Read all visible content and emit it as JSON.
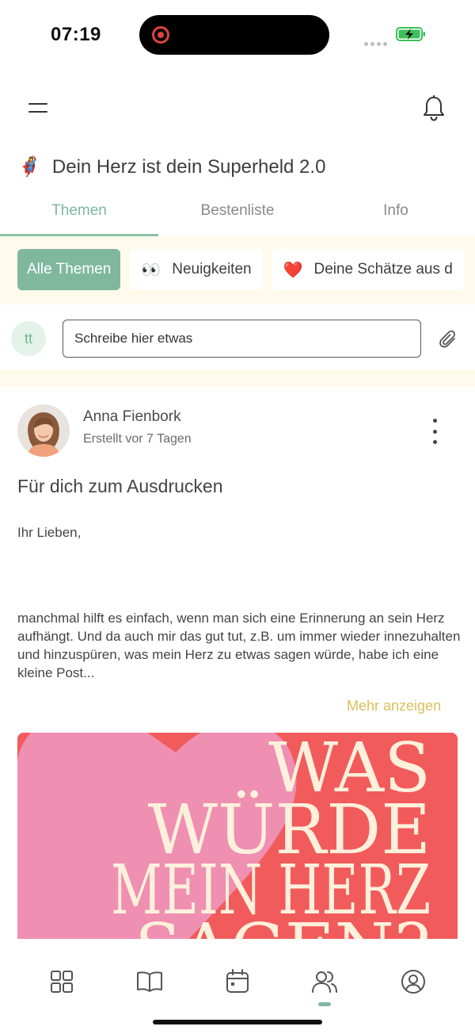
{
  "status_bar": {
    "time": "07:19"
  },
  "header": {
    "group_emoji": "🦸‍♀️",
    "group_name": "Dein Herz ist dein Superheld 2.0"
  },
  "tabs": [
    {
      "label": "Themen",
      "active": true
    },
    {
      "label": "Bestenliste",
      "active": false
    },
    {
      "label": "Info",
      "active": false
    }
  ],
  "filters": [
    {
      "emoji": "",
      "label": "Alle Themen",
      "active": true
    },
    {
      "emoji": "👀",
      "label": "Neuigkeiten",
      "active": false
    },
    {
      "emoji": "❤️",
      "label": "Deine Schätze aus d",
      "active": false
    }
  ],
  "composer": {
    "avatar_initials": "tt",
    "placeholder": "Schreibe hier etwas"
  },
  "post": {
    "author": "Anna Fienbork",
    "meta": "Erstellt vor 7 Tagen",
    "title": "Für dich zum Ausdrucken",
    "greeting": "Ihr Lieben,",
    "body": "manchmal hilft es einfach, wenn man sich eine Erinnerung an sein Herz aufhängt. Und da auch mir das gut tut, z.B. um immer wieder innezuhalten und hinzuspüren, was mein Herz zu etwas sagen würde, habe ich eine kleine Post...",
    "show_more": "Mehr anzeigen",
    "image_text": [
      "WAS",
      "WÜRDE",
      "MEIN HERZ",
      "SAGEN?"
    ]
  },
  "bottom_nav": [
    {
      "icon": "grid-icon"
    },
    {
      "icon": "book-icon"
    },
    {
      "icon": "calendar-icon"
    },
    {
      "icon": "community-icon",
      "active": true
    },
    {
      "icon": "profile-icon"
    }
  ],
  "colors": {
    "accent_green": "#7fb89f",
    "cream_band": "#fffaeb",
    "show_more_yellow": "#d9c15a",
    "poster_red": "#f25b5b",
    "poster_pink": "#ef8fb1",
    "poster_text": "#fdf0dc"
  }
}
